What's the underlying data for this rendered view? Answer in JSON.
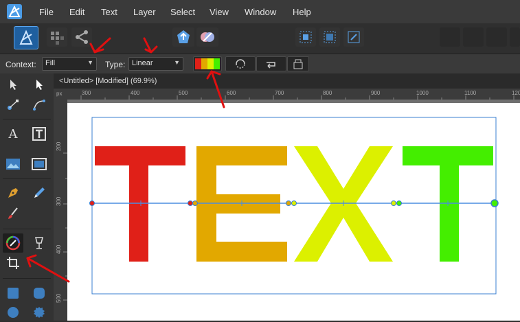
{
  "menu": [
    "File",
    "Edit",
    "Text",
    "Layer",
    "Select",
    "View",
    "Window",
    "Help"
  ],
  "context": {
    "context_label": "Context:",
    "context_value": "Fill",
    "type_label": "Type:",
    "type_value": "Linear"
  },
  "document": {
    "tab_title": "<Untitled> [Modified] (69.9%)"
  },
  "ruler": {
    "unit": "px",
    "top_ticks": [
      "300",
      "400",
      "500",
      "600",
      "700",
      "800",
      "900",
      "1000",
      "1100",
      "120"
    ],
    "left_ticks": [
      "200",
      "300",
      "400",
      "500"
    ]
  },
  "canvas": {
    "text_letters": [
      "T",
      "E",
      "X",
      "T"
    ],
    "letter_colors": [
      "#e02018",
      "#e2a800",
      "#dcf000",
      "#44ee00"
    ],
    "gradient_stops": [
      "#e02018",
      "#e2a800",
      "#dcf000",
      "#44ee00"
    ]
  },
  "colors": {
    "accent": "#3a8fd6",
    "annotation": "#e01010"
  }
}
